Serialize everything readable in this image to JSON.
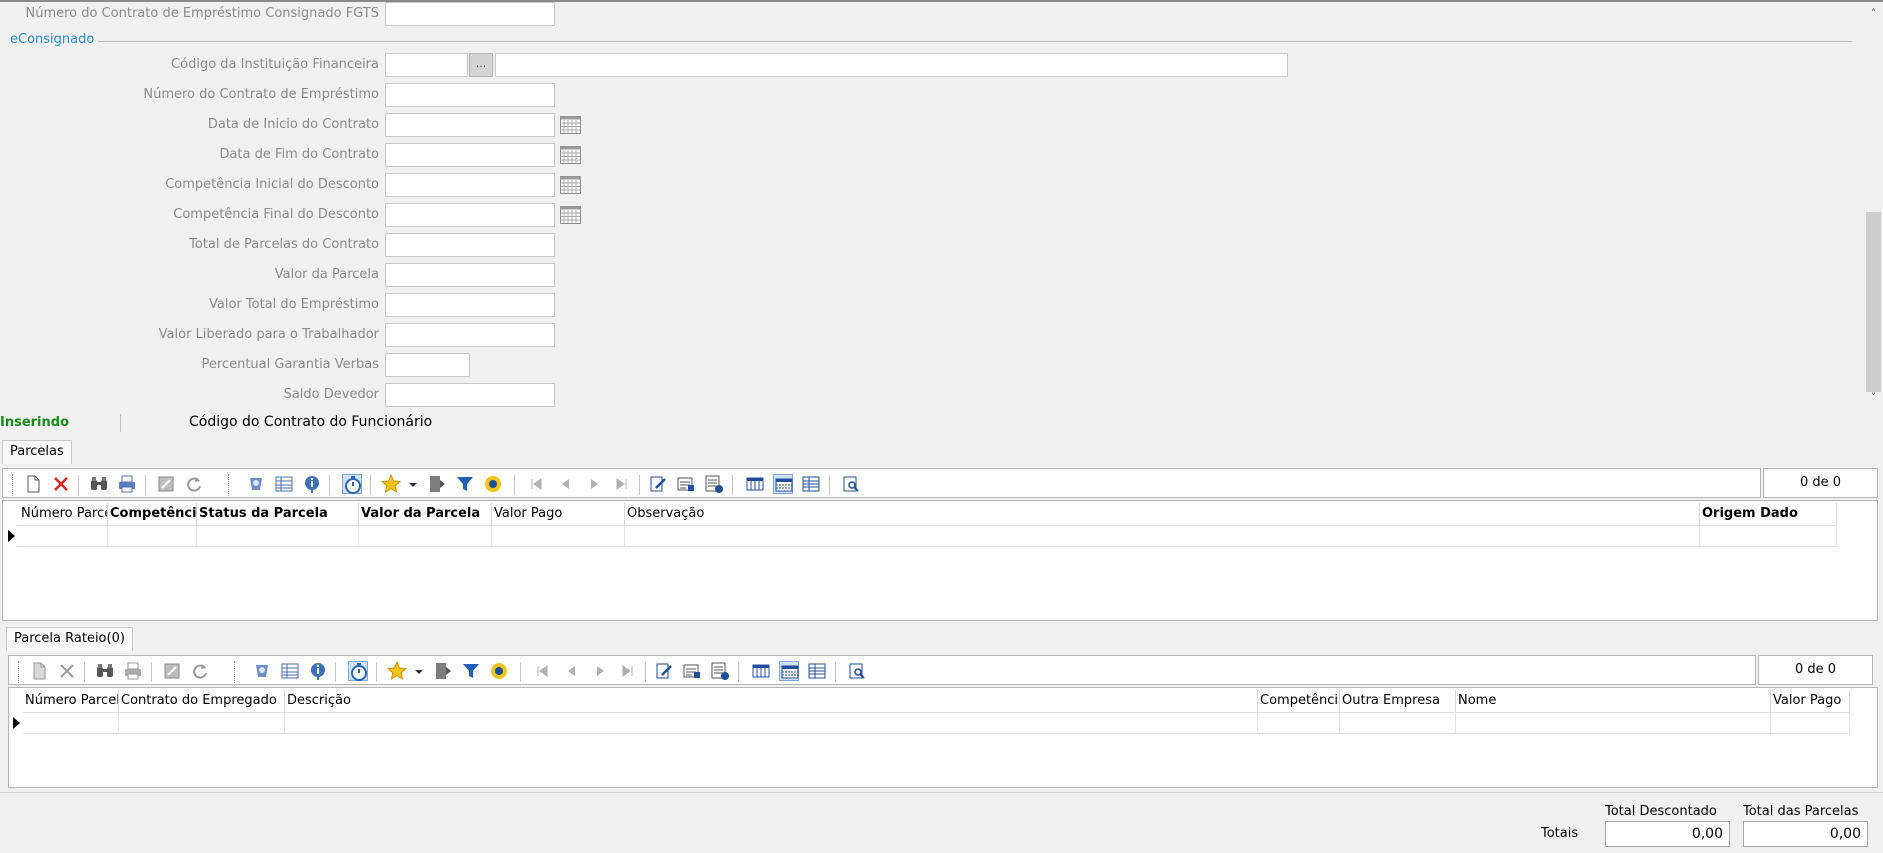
{
  "form": {
    "top_field_label": "Número do Contrato de Empréstimo Consignado FGTS",
    "section_title": "eConsignado",
    "ellipsis_label": "...",
    "fields": [
      {
        "label": "Código da Instituição Financeira",
        "value": ""
      },
      {
        "label": "Número do Contrato de Empréstimo",
        "value": ""
      },
      {
        "label": "Data de Inicio do Contrato",
        "value": ""
      },
      {
        "label": "Data de Fim do Contrato",
        "value": ""
      },
      {
        "label": "Competência Inicial do Desconto",
        "value": ""
      },
      {
        "label": "Competência Final do Desconto",
        "value": ""
      },
      {
        "label": "Total de Parcelas do Contrato",
        "value": ""
      },
      {
        "label": "Valor da Parcela",
        "value": ""
      },
      {
        "label": "Valor Total do Empréstimo",
        "value": ""
      },
      {
        "label": "Valor Liberado para o Trabalhador",
        "value": ""
      },
      {
        "label": "Percentual Garantia Verbas",
        "value": ""
      },
      {
        "label": "Saldo Devedor",
        "value": ""
      }
    ]
  },
  "status": {
    "mode": "Inserindo",
    "field": "Código do Contrato do Funcionário"
  },
  "parcelas": {
    "tab_label": "Parcelas",
    "record_count": "0 de 0",
    "columns": [
      "Número Parcela",
      "Competência",
      "Status da Parcela",
      "Valor da Parcela",
      "Valor Pago",
      "Observação",
      "Origem Dado"
    ]
  },
  "rateio": {
    "tab_label": "Parcela Rateio(0)",
    "record_count": "0 de 0",
    "columns": [
      "Número Parcela",
      "Contrato do Empregado",
      "Descrição",
      "Competência",
      "Outra Empresa",
      "Nome",
      "Valor Pago"
    ]
  },
  "totals": {
    "label": "Totais",
    "total_descontado_label": "Total Descontado",
    "total_descontado_value": "0,00",
    "total_parcelas_label": "Total das Parcelas",
    "total_parcelas_value": "0,00"
  },
  "colors": {
    "section_title": "#2a8ad4",
    "status_mode": "#1a8a1a",
    "delete_red": "#e02020"
  }
}
